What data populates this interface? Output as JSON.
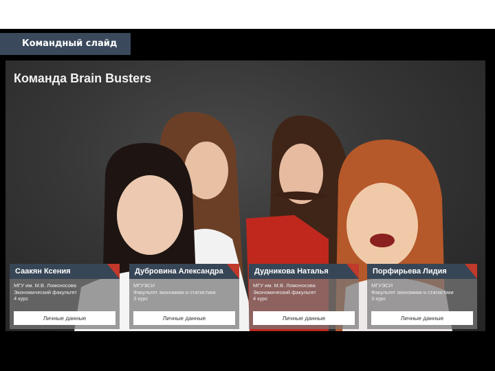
{
  "header": {
    "label": "Командный слайд"
  },
  "slide": {
    "title": "Команда Brain Busters",
    "members": [
      {
        "name": "Саакян Ксения",
        "line1": "МГУ им. М.В. Ломоносова",
        "line2": "Экономический факультет",
        "line3": "4 курс",
        "button": "Личные данные"
      },
      {
        "name": "Дубровина Александра",
        "line1": "МГУЭСИ",
        "line2": "Факультет экономики и статистики",
        "line3": "3 курс",
        "button": "Личные данные"
      },
      {
        "name": "Дудникова Наталья",
        "line1": "МГУ им. М.В. Ломоносова",
        "line2": "Экономический факультет",
        "line3": "4 курс",
        "button": "Личные данные"
      },
      {
        "name": "Порфирьева Лидия",
        "line1": "МГУЭСИ",
        "line2": "Факультет экономики и статистики",
        "line3": "3 курс",
        "button": "Личные данные"
      }
    ]
  },
  "colors": {
    "label_bg": "#3a4a5c",
    "name_bar": "#374656",
    "accent": "#c0392b"
  }
}
